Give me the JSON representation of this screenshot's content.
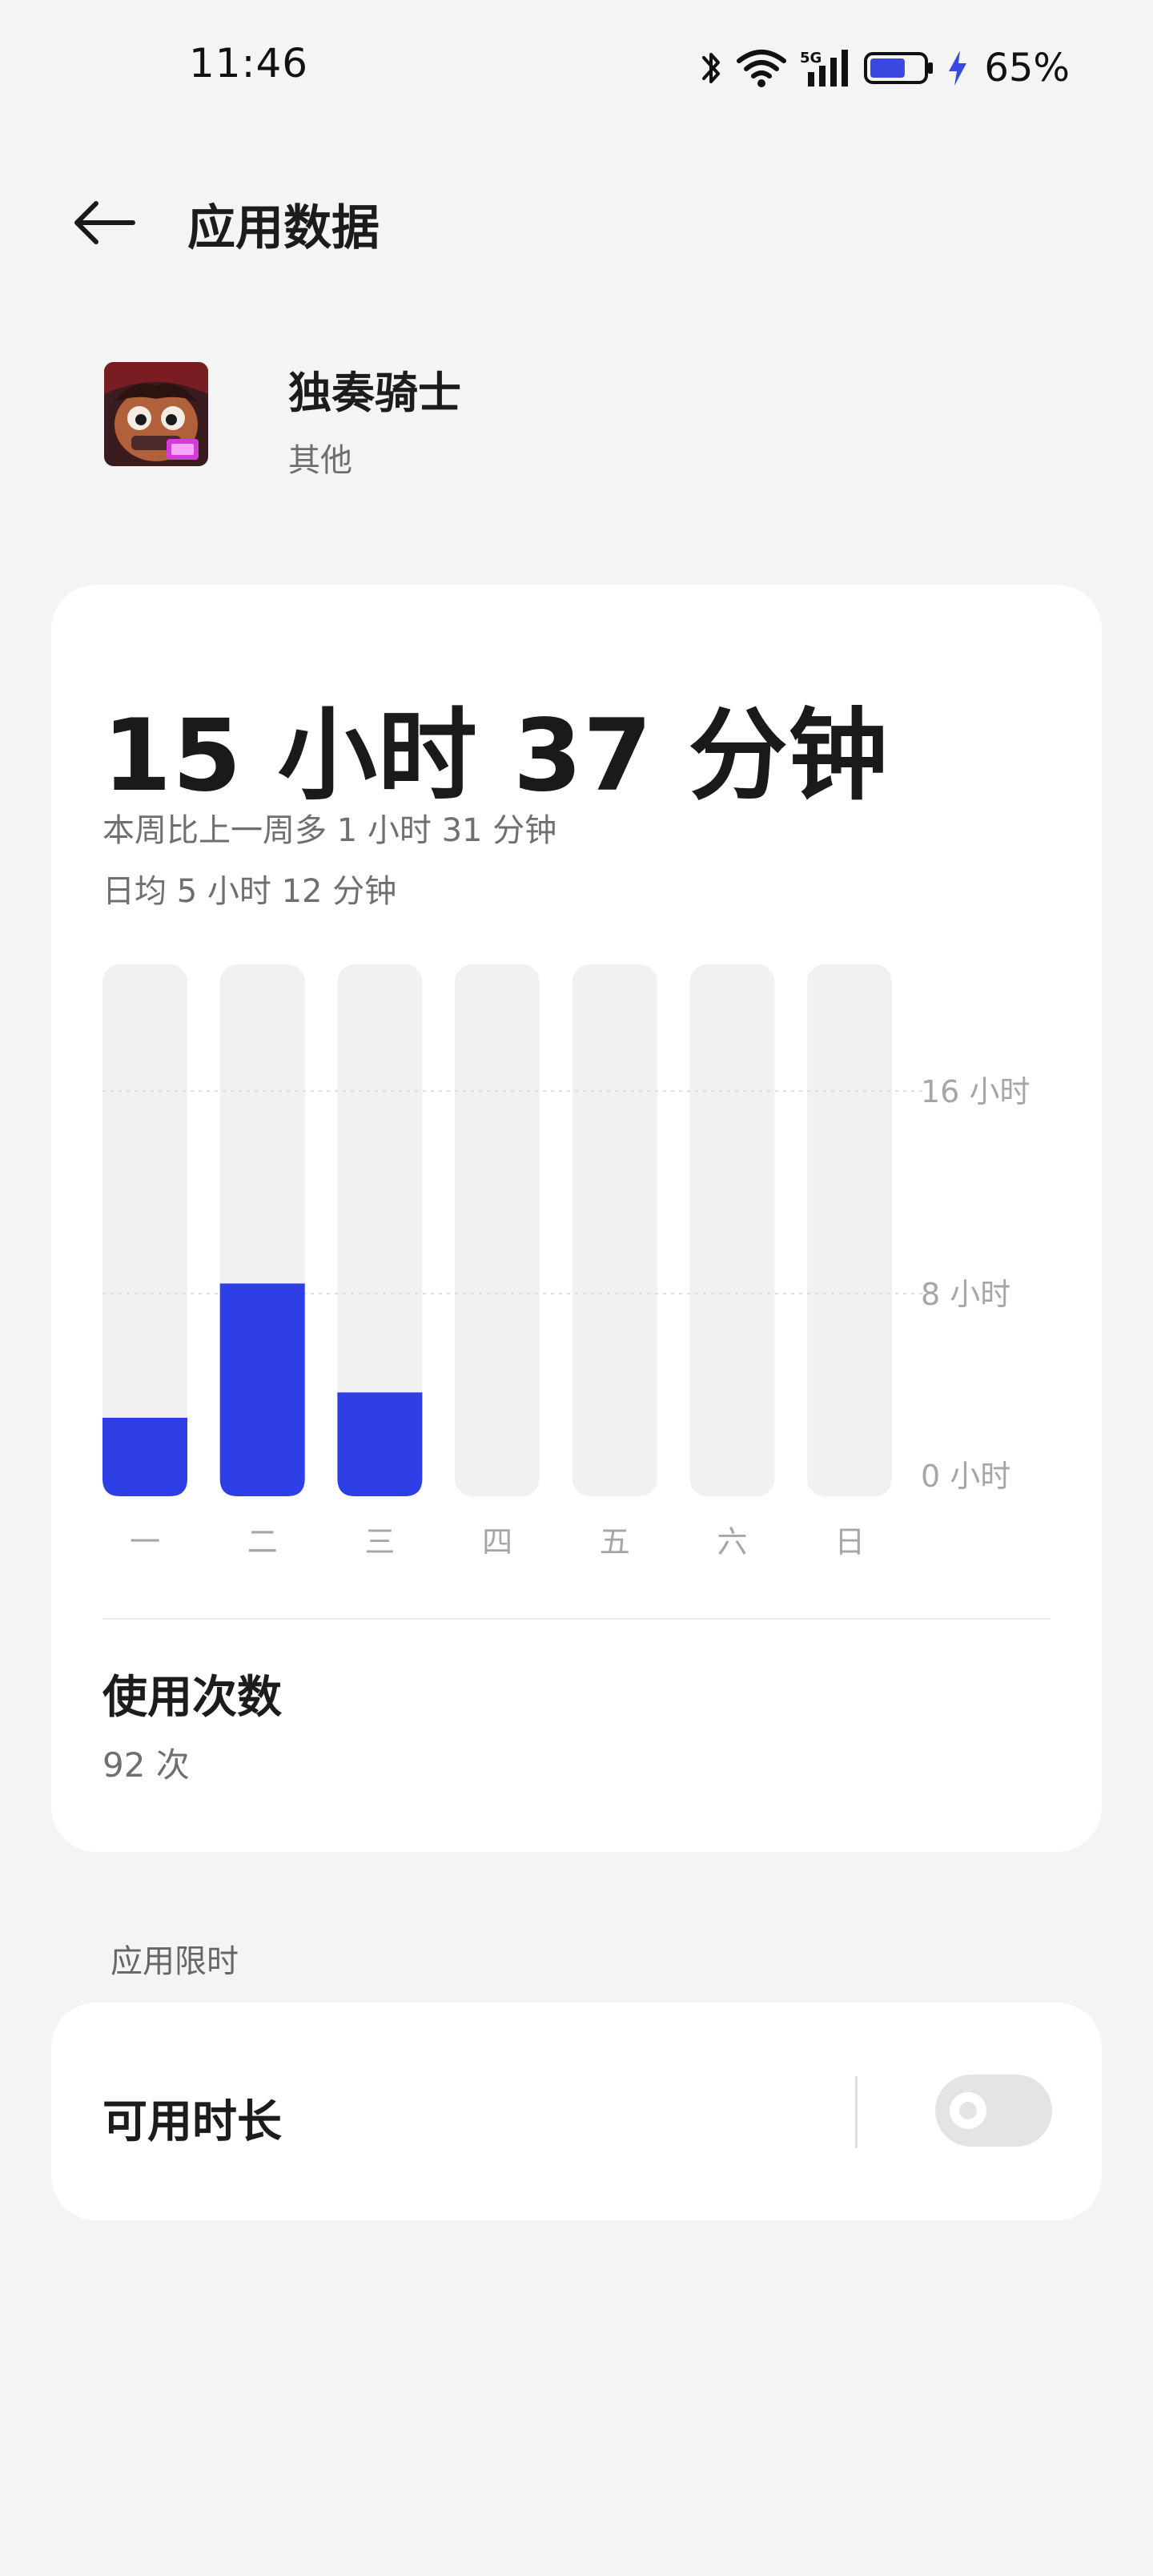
{
  "status_bar": {
    "time": "11:46",
    "icons": [
      "bluetooth-icon",
      "wifi-icon",
      "5g-signal-icon",
      "battery-icon",
      "charging-icon"
    ],
    "signal_label": "5G",
    "battery_level": 65,
    "battery_text": "65%"
  },
  "header": {
    "back_icon": "arrow-left-icon",
    "title": "应用数据"
  },
  "app": {
    "name": "独奏骑士",
    "category": "其他"
  },
  "usage": {
    "total": "15 小时 37 分钟",
    "compare": "本周比上一周多 1 小时 31 分钟",
    "daily_avg": "日均 5 小时 12 分钟"
  },
  "chart_data": {
    "type": "bar",
    "categories": [
      "一",
      "二",
      "三",
      "四",
      "五",
      "六",
      "日"
    ],
    "values": [
      3.1,
      8.4,
      4.1,
      0,
      0,
      0,
      0
    ],
    "ylim": [
      0,
      21
    ],
    "yticks": [
      {
        "value": 16,
        "label": "16 小时"
      },
      {
        "value": 8,
        "label": "8 小时"
      },
      {
        "value": 0,
        "label": "0 小时"
      }
    ],
    "grid": true,
    "colors": {
      "bar": "#2e3fe6",
      "track": "#f1f1f1",
      "grid": "#dedede",
      "label": "#a6a6a6"
    }
  },
  "launch_count": {
    "title": "使用次数",
    "value": "92 次"
  },
  "limit_section": {
    "label": "应用限时",
    "row_title": "可用时长",
    "toggle_on": false
  }
}
